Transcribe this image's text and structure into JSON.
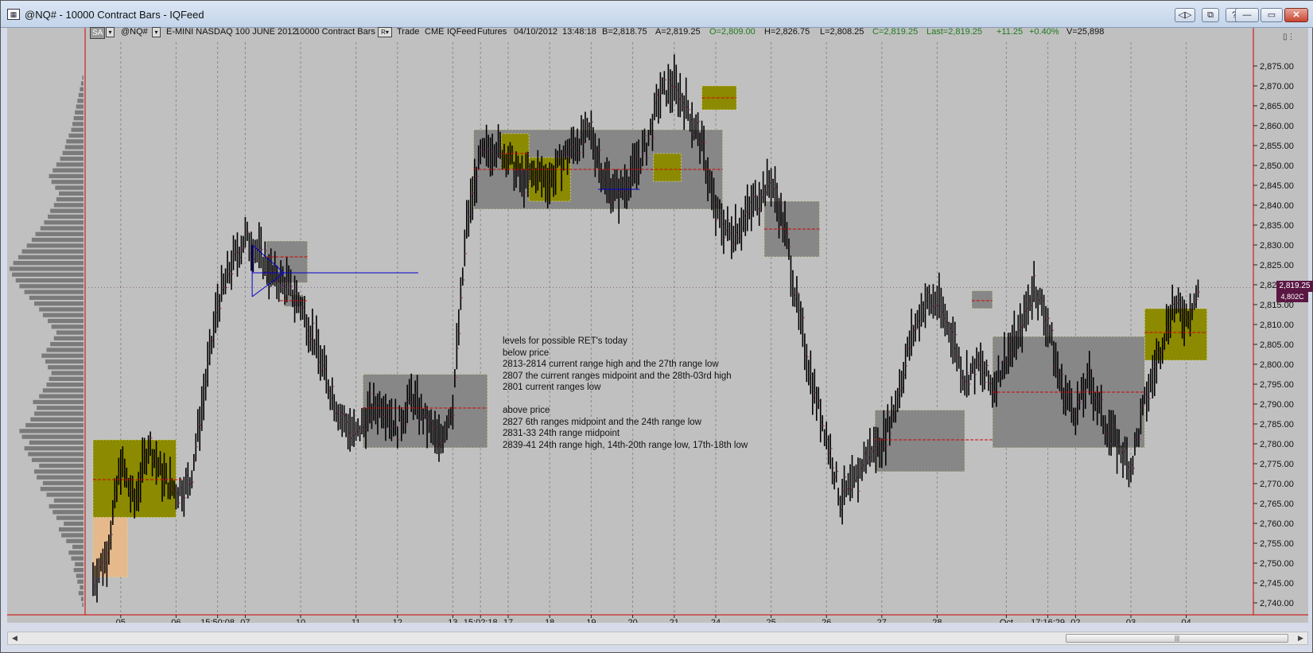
{
  "window": {
    "title": "@NQ# - 10000 Contract Bars - IQFeed",
    "app_icon": "chart-icon"
  },
  "title_buttons": {
    "restore_dual": "◁▷",
    "copy": "⧉",
    "help": "?",
    "minimize": "—",
    "maximize": "▭",
    "close": "✕"
  },
  "infobar": {
    "sa_label": "SA",
    "symbol": "@NQ#",
    "description": "E-MINI NASDAQ 100 JUNE 2012",
    "bars": "10000 Contract Bars",
    "r_label": "R",
    "trade": "Trade",
    "exchange": "CME",
    "feed": "IQFeed",
    "type": "Futures",
    "date": "04/10/2012",
    "time": "13:48:18",
    "bid": "B=2,818.75",
    "ask": "A=2,819.25",
    "open": "O=2,809.00",
    "high": "H=2,826.75",
    "low": "L=2,808.25",
    "close": "C=2,819.25",
    "last": "Last=2,819.25",
    "change": "+11.25",
    "change_pct": "+0.40%",
    "volume": "V=25,898"
  },
  "notes": [
    "levels for possible RET's today",
    "below price",
    "2813-2814 current range high and the 27th range low",
    "2807 the current ranges midpoint and the 28th-03rd high",
    "2801 current ranges low",
    "",
    " above price",
    " 2827 6th ranges  midpoint and the 24th range  low",
    " 2831-33 24th range midpoint",
    " 2839-41 24th range high, 14th-20th range low, 17th-18th low"
  ],
  "price_tags": {
    "last": "2,819.25",
    "volume": "4,802C"
  },
  "colors": {
    "chart_bg": "#c0c0c0",
    "gray_box": "#878787",
    "olive_box": "#8c8a00",
    "peach_box": "#e6b98c",
    "bar": "#000000",
    "red_line": "#d00000",
    "blue_line": "#0000cc",
    "accent_tag": "#5a1743"
  },
  "chart_data": {
    "type": "ohlc-bar",
    "symbol": "@NQ#",
    "y_ticks": [
      "2,875.00",
      "2,870.00",
      "2,865.00",
      "2,860.00",
      "2,855.00",
      "2,850.00",
      "2,845.00",
      "2,840.00",
      "2,835.00",
      "2,830.00",
      "2,825.00",
      "2,820.00",
      "2,815.00",
      "2,810.00",
      "2,805.00",
      "2,800.00",
      "2,795.00",
      "2,790.00",
      "2,785.00",
      "2,780.00",
      "2,775.00",
      "2,770.00",
      "2,765.00",
      "2,760.00",
      "2,755.00",
      "2,750.00",
      "2,745.00",
      "2,740.00"
    ],
    "ylim": [
      2737,
      2881
    ],
    "x_labels": [
      {
        "label": "05",
        "i": 2
      },
      {
        "label": "06",
        "i": 6
      },
      {
        "label": "15:50:08",
        "i": 9
      },
      {
        "label": "07",
        "i": 11
      },
      {
        "label": "10",
        "i": 15
      },
      {
        "label": "11",
        "i": 19
      },
      {
        "label": "12",
        "i": 22
      },
      {
        "label": "13",
        "i": 26
      },
      {
        "label": "15:02:18",
        "i": 28
      },
      {
        "label": "17",
        "i": 30
      },
      {
        "label": "18",
        "i": 33
      },
      {
        "label": "19",
        "i": 36
      },
      {
        "label": "20",
        "i": 39
      },
      {
        "label": "21",
        "i": 42
      },
      {
        "label": "24",
        "i": 45
      },
      {
        "label": "25",
        "i": 49
      },
      {
        "label": "26",
        "i": 53
      },
      {
        "label": "27",
        "i": 57
      },
      {
        "label": "28",
        "i": 61
      },
      {
        "label": "Oct",
        "i": 66
      },
      {
        "label": "17:16:29",
        "i": 69
      },
      {
        "label": "02",
        "i": 71
      },
      {
        "label": "03",
        "i": 75
      },
      {
        "label": "04",
        "i": 79
      }
    ],
    "n_slots": 82,
    "path": [
      [
        0,
        2746
      ],
      [
        1,
        2752
      ],
      [
        2,
        2775
      ],
      [
        3,
        2765
      ],
      [
        4,
        2780
      ],
      [
        5,
        2772
      ],
      [
        6,
        2768
      ],
      [
        7,
        2770
      ],
      [
        8,
        2792
      ],
      [
        9,
        2815
      ],
      [
        10,
        2825
      ],
      [
        11,
        2832
      ],
      [
        12,
        2828
      ],
      [
        13,
        2822
      ],
      [
        14,
        2820
      ],
      [
        15,
        2815
      ],
      [
        16,
        2806
      ],
      [
        17,
        2795
      ],
      [
        18,
        2786
      ],
      [
        19,
        2782
      ],
      [
        20,
        2788
      ],
      [
        21,
        2790
      ],
      [
        22,
        2784
      ],
      [
        23,
        2792
      ],
      [
        24,
        2786
      ],
      [
        25,
        2780
      ],
      [
        26,
        2790
      ],
      [
        27,
        2835
      ],
      [
        28,
        2852
      ],
      [
        29,
        2855
      ],
      [
        30,
        2852
      ],
      [
        31,
        2846
      ],
      [
        32,
        2848
      ],
      [
        33,
        2846
      ],
      [
        34,
        2852
      ],
      [
        35,
        2856
      ],
      [
        36,
        2858
      ],
      [
        37,
        2846
      ],
      [
        38,
        2843
      ],
      [
        39,
        2848
      ],
      [
        40,
        2855
      ],
      [
        41,
        2868
      ],
      [
        42,
        2870
      ],
      [
        43,
        2864
      ],
      [
        44,
        2855
      ],
      [
        45,
        2838
      ],
      [
        46,
        2833
      ],
      [
        47,
        2836
      ],
      [
        48,
        2842
      ],
      [
        49,
        2846
      ],
      [
        50,
        2834
      ],
      [
        51,
        2812
      ],
      [
        52,
        2795
      ],
      [
        53,
        2782
      ],
      [
        54,
        2766
      ],
      [
        55,
        2770
      ],
      [
        56,
        2778
      ],
      [
        57,
        2780
      ],
      [
        58,
        2790
      ],
      [
        59,
        2805
      ],
      [
        60,
        2815
      ],
      [
        61,
        2816
      ],
      [
        62,
        2808
      ],
      [
        63,
        2796
      ],
      [
        64,
        2800
      ],
      [
        65,
        2794
      ],
      [
        66,
        2802
      ],
      [
        67,
        2808
      ],
      [
        68,
        2820
      ],
      [
        69,
        2810
      ],
      [
        70,
        2794
      ],
      [
        71,
        2788
      ],
      [
        72,
        2796
      ],
      [
        73,
        2786
      ],
      [
        74,
        2780
      ],
      [
        75,
        2774
      ],
      [
        76,
        2790
      ],
      [
        77,
        2802
      ],
      [
        78,
        2815
      ],
      [
        79,
        2812
      ],
      [
        80,
        2819
      ]
    ],
    "range_boxes": [
      {
        "color": "gray",
        "i0": 13.8,
        "i1": 15.2,
        "y0": 2814.5,
        "y1": 2817.5
      },
      {
        "color": "gray",
        "i0": 12.5,
        "i1": 15.5,
        "y0": 2820.5,
        "y1": 2831
      },
      {
        "color": "gray",
        "i0": 19.5,
        "i1": 28.5,
        "y0": 2779,
        "y1": 2797.5
      },
      {
        "color": "gray",
        "i0": 27.5,
        "i1": 45.5,
        "y0": 2839,
        "y1": 2859
      },
      {
        "color": "gray",
        "i0": 48.5,
        "i1": 52.5,
        "y0": 2827,
        "y1": 2841
      },
      {
        "color": "gray",
        "i0": 56.5,
        "i1": 63,
        "y0": 2773,
        "y1": 2788.5
      },
      {
        "color": "gray",
        "i0": 63.5,
        "i1": 65,
        "y0": 2814,
        "y1": 2818.5
      },
      {
        "color": "gray",
        "i0": 65,
        "i1": 76,
        "y0": 2779,
        "y1": 2807
      },
      {
        "color": "olive",
        "i0": 0,
        "i1": 6,
        "y0": 2761.5,
        "y1": 2781
      },
      {
        "color": "peach",
        "i0": 0,
        "i1": 2.5,
        "y0": 2746.5,
        "y1": 2761.5
      },
      {
        "color": "olive",
        "i0": 29.5,
        "i1": 31.5,
        "y0": 2849,
        "y1": 2858
      },
      {
        "color": "olive",
        "i0": 31.5,
        "i1": 34.5,
        "y0": 2841,
        "y1": 2852
      },
      {
        "color": "olive",
        "i0": 40.5,
        "i1": 42.5,
        "y0": 2846,
        "y1": 2853
      },
      {
        "color": "olive",
        "i0": 44,
        "i1": 46.5,
        "y0": 2864,
        "y1": 2870
      },
      {
        "color": "olive",
        "i0": 76,
        "i1": 80.5,
        "y0": 2801,
        "y1": 2814
      }
    ],
    "midlines": [
      {
        "i0": 13.5,
        "i1": 15.5,
        "y": 2816
      },
      {
        "i0": 12.5,
        "i1": 15.5,
        "y": 2827
      },
      {
        "i0": 0,
        "i1": 6.5,
        "y": 2771
      },
      {
        "i0": 19.5,
        "i1": 28.5,
        "y": 2789
      },
      {
        "i0": 27.5,
        "i1": 45.5,
        "y": 2849
      },
      {
        "i0": 29.5,
        "i1": 31.5,
        "y": 2853
      },
      {
        "i0": 44,
        "i1": 46.5,
        "y": 2867
      },
      {
        "i0": 48.5,
        "i1": 52.5,
        "y": 2834
      },
      {
        "i0": 56.5,
        "i1": 65,
        "y": 2781
      },
      {
        "i0": 63.5,
        "i1": 65,
        "y": 2816
      },
      {
        "i0": 65,
        "i1": 76,
        "y": 2793
      },
      {
        "i0": 76,
        "i1": 80.5,
        "y": 2808
      }
    ],
    "blue_lines": [
      {
        "i0": 11.5,
        "i1": 23.5,
        "y0": 2823,
        "y1": 2823
      },
      {
        "i0": 11.5,
        "i1": 13.8,
        "y0": 2817,
        "y1": 2823
      },
      {
        "i0": 11.5,
        "i1": 13.8,
        "y0": 2830,
        "y1": 2823
      },
      {
        "i0": 11.5,
        "i1": 11.5,
        "y0": 2817,
        "y1": 2830
      },
      {
        "i0": 36.5,
        "i1": 39.5,
        "y0": 2844,
        "y1": 2844
      }
    ],
    "profile": [
      1,
      2,
      4,
      3,
      5,
      6,
      8,
      7,
      10,
      12,
      9,
      14,
      18,
      20,
      16,
      22,
      25,
      28,
      24,
      30,
      35,
      33,
      38,
      40,
      36,
      42,
      45,
      48,
      44,
      50,
      52,
      47,
      43,
      40,
      38,
      41,
      36,
      33,
      30,
      28,
      26,
      29,
      31,
      34,
      30,
      27,
      24,
      22,
      26,
      29,
      33,
      36,
      40,
      44,
      48,
      52,
      55,
      58,
      60,
      57,
      53,
      50,
      46,
      42,
      39,
      35,
      32,
      29,
      27,
      24,
      22,
      20,
      23,
      26,
      28,
      25,
      22,
      19,
      17,
      15,
      14,
      12,
      10,
      9,
      8,
      7,
      6,
      5,
      4,
      3,
      2,
      1
    ]
  }
}
